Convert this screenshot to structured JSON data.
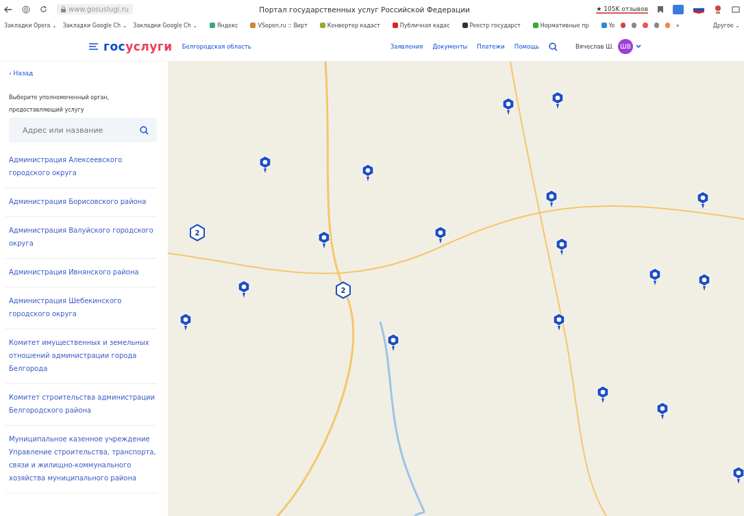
{
  "browser": {
    "address": "www.gosuslugi.ru",
    "title": "Портал государственных услуг Российской Федерации",
    "reviews": "★ 105K отзывов",
    "bookmarks": [
      {
        "label": "Закладки Opera ⌄",
        "kind": "folder"
      },
      {
        "label": "Закладки Google Ch ⌄",
        "kind": "folder"
      },
      {
        "label": "Закладки Google Ch ⌄",
        "kind": "folder"
      },
      {
        "label": "Яндекс",
        "kind": "site"
      },
      {
        "label": "VSopen.ru :: Вирт",
        "kind": "site"
      },
      {
        "label": "Конвертер кадаст",
        "kind": "site"
      },
      {
        "label": "Публичная кадас",
        "kind": "site"
      },
      {
        "label": "Реестр государст",
        "kind": "site"
      },
      {
        "label": "Нормативные пр",
        "kind": "site"
      },
      {
        "label": "Yo",
        "kind": "site"
      },
      {
        "label": "»",
        "kind": "more"
      },
      {
        "label": "Другое ⌄",
        "kind": "folder"
      }
    ]
  },
  "header": {
    "logo_first": "гос",
    "logo_second": "услуги",
    "region": "Белгородская область",
    "nav": [
      "Заявления",
      "Документы",
      "Платежи",
      "Помощь"
    ],
    "user": "Вячеслав Ш.",
    "avatar": "ШВ"
  },
  "panel": {
    "back": "‹ Назад",
    "prompt": "Выберите уполномоченный орган, предоставляющий услугу",
    "search": {
      "placeholder": "Адрес или название"
    },
    "items": [
      "Администрация Алексеевского городского округа",
      "Администрация Борисовского района",
      "Администрация Валуйского городского округа",
      "Администрация Ивнянского района",
      "Администрация Шебекинского городского округа",
      "Комитет имущественных и земельных отношений администрации города Белгорода",
      "Комитет строительства администрации Белгородского района",
      "Муниципальное казенное учреждение Управление строительства, транспорта, связи и жилищно-коммунального хозяйства муниципального района"
    ]
  },
  "map": {
    "markers": [
      {
        "kind": "pin"
      },
      {
        "kind": "pin"
      },
      {
        "kind": "pin"
      },
      {
        "kind": "pin"
      },
      {
        "kind": "pin"
      },
      {
        "kind": "pin"
      },
      {
        "kind": "pin"
      },
      {
        "kind": "pin"
      },
      {
        "kind": "pin"
      },
      {
        "kind": "pin"
      },
      {
        "kind": "pin"
      },
      {
        "kind": "pin"
      },
      {
        "kind": "pin"
      },
      {
        "kind": "pin"
      },
      {
        "kind": "pin"
      },
      {
        "kind": "pin"
      },
      {
        "kind": "pin"
      },
      {
        "kind": "pin"
      },
      {
        "kind": "cluster",
        "count": "2"
      },
      {
        "kind": "cluster",
        "count": "2"
      }
    ]
  }
}
